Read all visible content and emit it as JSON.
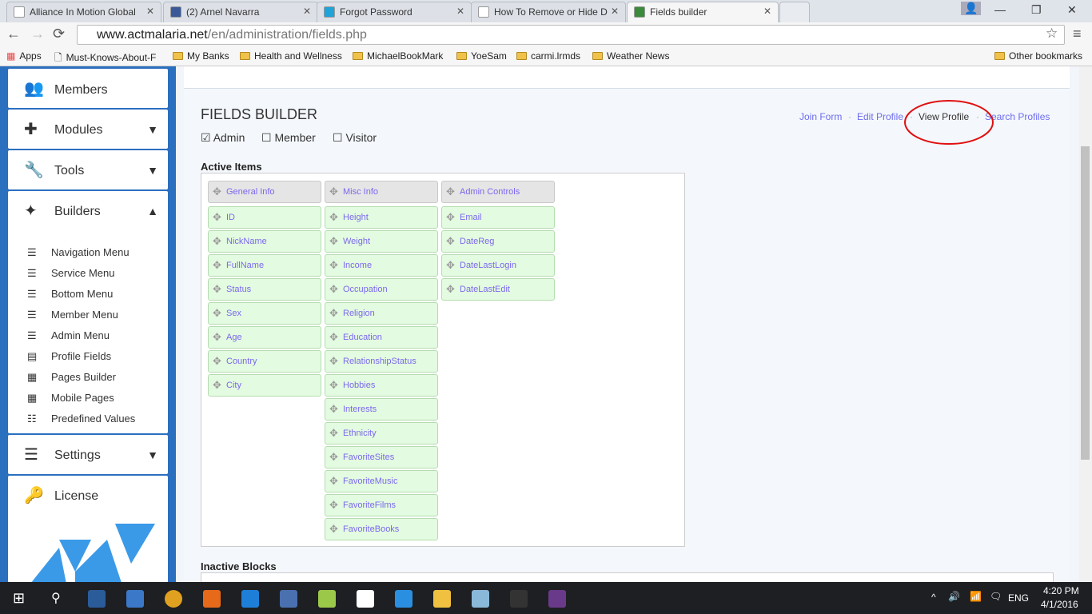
{
  "browser": {
    "tabs": [
      {
        "title": "Alliance In Motion Global",
        "icon": "page-icon",
        "color": "#ffffff"
      },
      {
        "title": "(2) Arnel Navarra",
        "icon": "facebook-icon",
        "color": "#3b5998"
      },
      {
        "title": "Forgot Password",
        "icon": "site-icon",
        "color": "#1fa3d8"
      },
      {
        "title": "How To Remove or Hide D",
        "icon": "infinity-icon",
        "color": "#ffffff"
      },
      {
        "title": "Fields builder",
        "icon": "globe-icon",
        "color": "#3c8a3c"
      }
    ],
    "url_domain": "www.actmalaria.net",
    "url_path": "/en/administration/fields.php",
    "bookmarks": [
      "Apps",
      "Must-Knows-About-F",
      "My Banks",
      "Health and Wellness",
      "MichaelBookMark",
      "YoeSam",
      "carmi.lrmds",
      "Weather News"
    ],
    "other_bookmarks": "Other bookmarks"
  },
  "sidebar": {
    "sections": [
      {
        "label": "Members",
        "icon": "users-icon"
      },
      {
        "label": "Modules",
        "icon": "puzzle-icon"
      },
      {
        "label": "Tools",
        "icon": "wrench-icon"
      },
      {
        "label": "Builders",
        "icon": "magic-wand-icon"
      },
      {
        "label": "Settings",
        "icon": "sliders-icon"
      },
      {
        "label": "License",
        "icon": "key-icon"
      }
    ],
    "builders": [
      "Navigation Menu",
      "Service Menu",
      "Bottom Menu",
      "Member Menu",
      "Admin Menu",
      "Profile Fields",
      "Pages Builder",
      "Mobile Pages",
      "Predefined Values"
    ]
  },
  "main": {
    "title": "FIELDS BUILDER",
    "roles": [
      {
        "label": "Admin",
        "checked": true
      },
      {
        "label": "Member",
        "checked": false
      },
      {
        "label": "Visitor",
        "checked": false
      }
    ],
    "links": [
      "Join Form",
      "Edit Profile",
      "View Profile",
      "Search Profiles"
    ],
    "active_label": "Active Items",
    "inactive_label": "Inactive Blocks",
    "columns": [
      {
        "header": "General Info",
        "items": [
          "ID",
          "NickName",
          "FullName",
          "Status",
          "Sex",
          "Age",
          "Country",
          "City"
        ]
      },
      {
        "header": "Misc Info",
        "items": [
          "Height",
          "Weight",
          "Income",
          "Occupation",
          "Religion",
          "Education",
          "RelationshipStatus",
          "Hobbies",
          "Interests",
          "Ethnicity",
          "FavoriteSites",
          "FavoriteMusic",
          "FavoriteFilms",
          "FavoriteBooks"
        ]
      },
      {
        "header": "Admin Controls",
        "items": [
          "Email",
          "DateReg",
          "DateLastLogin",
          "DateLastEdit"
        ]
      }
    ]
  },
  "taskbar": {
    "lang": "ENG",
    "time": "4:20 PM",
    "date": "4/1/2016"
  }
}
